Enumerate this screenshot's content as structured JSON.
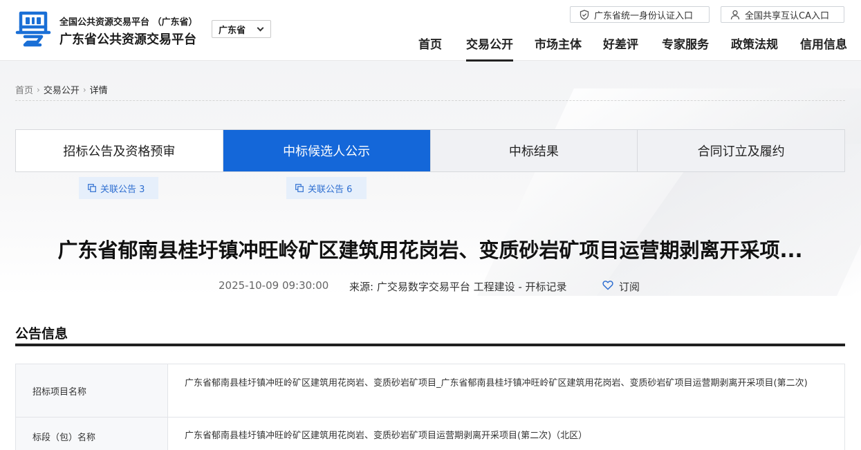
{
  "header": {
    "brand_small": "全国公共资源交易平台 （广东省）",
    "brand_big": "广东省公共资源交易平台",
    "region": "广东省",
    "top_links": {
      "identity": "广东省统一身份认证入口",
      "ca": "全国共享互认CA入口"
    },
    "nav": [
      "首页",
      "交易公开",
      "市场主体",
      "好差评",
      "专家服务",
      "政策法规",
      "信用信息"
    ],
    "active_nav": "交易公开"
  },
  "breadcrumb": [
    "首页",
    "交易公开",
    "详情"
  ],
  "stage_tabs": [
    "招标公告及资格预审",
    "中标候选人公示",
    "中标结果",
    "合同订立及履约"
  ],
  "active_tab": "中标候选人公示",
  "related": {
    "tab1": "关联公告 3",
    "tab2": "关联公告 6"
  },
  "article": {
    "title": "广东省郁南县桂圩镇冲旺岭矿区建筑用花岗岩、变质砂岩矿项目运营期剥离开采项...",
    "date": "2025-10-09 09:30:00",
    "source": "来源: 广交易数字交易平台 工程建设 - 开标记录",
    "subscribe": "订阅"
  },
  "section": {
    "title": "公告信息",
    "rows": [
      {
        "label": "招标项目名称",
        "value": "广东省郁南县桂圩镇冲旺岭矿区建筑用花岗岩、变质砂岩矿项目_广东省郁南县桂圩镇冲旺岭矿区建筑用花岗岩、变质砂岩矿项目运营期剥离开采项目(第二次)"
      },
      {
        "label": "标段（包）名称",
        "value": "广东省郁南县桂圩镇冲旺岭矿区建筑用花岗岩、变质砂岩矿项目运营期剥离开采项目(第二次)（北区）"
      }
    ]
  },
  "colors": {
    "primary_blue": "#1467d9",
    "link_blue": "#2f6fd1",
    "tag_bg": "#e6effb"
  },
  "icons": {
    "logo": "yue-logo",
    "identity_link": "shield-icon",
    "ca_link": "user-icon",
    "related": "copy-icon",
    "subscribe": "heart-icon",
    "region": "chevron-down-icon"
  }
}
